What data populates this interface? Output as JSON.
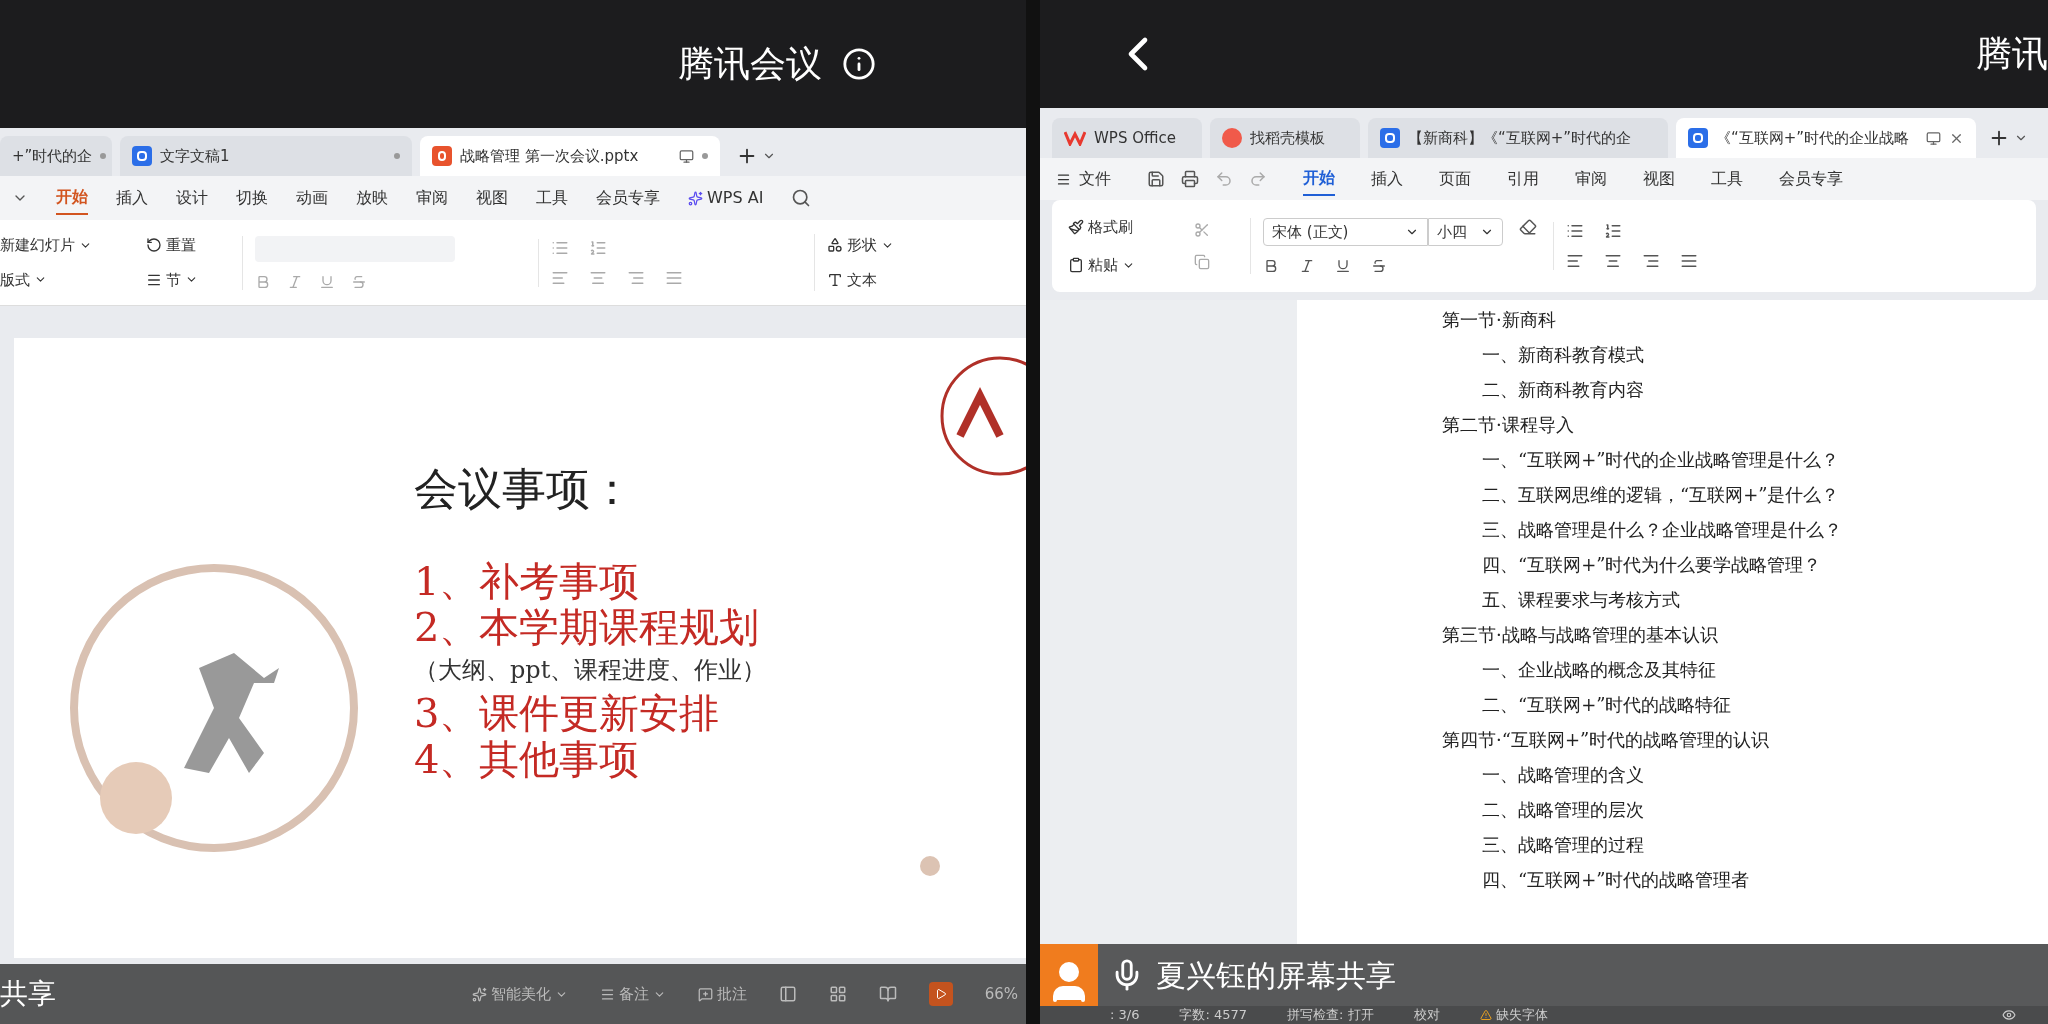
{
  "left": {
    "meeting_title": "腾讯会议",
    "tabs": [
      {
        "label": "+”时代的企",
        "kind": "none",
        "selected": false
      },
      {
        "label": "文字文稿1",
        "kind": "doc",
        "selected": false
      },
      {
        "label": "战略管理 第一次会议.pptx",
        "kind": "slides",
        "selected": true
      }
    ],
    "menu": [
      {
        "label": "开始",
        "selected": true
      },
      {
        "label": "插入",
        "selected": false
      },
      {
        "label": "设计",
        "selected": false
      },
      {
        "label": "切换",
        "selected": false
      },
      {
        "label": "动画",
        "selected": false
      },
      {
        "label": "放映",
        "selected": false
      },
      {
        "label": "审阅",
        "selected": false
      },
      {
        "label": "视图",
        "selected": false
      },
      {
        "label": "工具",
        "selected": false
      },
      {
        "label": "会员专享",
        "selected": false
      }
    ],
    "ai_label": "WPS AI",
    "ribbon": {
      "new_slide": "新建幻灯片",
      "reset": "重置",
      "layout": "版式",
      "section": "节",
      "shape": "形状",
      "textbox": "文本"
    },
    "slide": {
      "heading": "会议事项：",
      "items": [
        {
          "text": "1、补考事项",
          "kind": "main"
        },
        {
          "text": "2、本学期课程规划",
          "kind": "main"
        },
        {
          "text": "（大纲、ppt、课程进度、作业）",
          "kind": "note"
        },
        {
          "text": "3、课件更新安排",
          "kind": "main"
        },
        {
          "text": "4、其他事项",
          "kind": "main"
        }
      ]
    },
    "share_label": "共享",
    "status": {
      "beautify": "智能美化",
      "notes": "备注",
      "comment": "批注",
      "zoom": "66%"
    }
  },
  "right": {
    "meeting_title": "腾讯",
    "tabs": [
      {
        "label": "WPS Office",
        "kind": "wps",
        "selected": false
      },
      {
        "label": "找稻壳模板",
        "kind": "template",
        "selected": false
      },
      {
        "label": "【新商科】《“互联网+”时代的企",
        "kind": "doc",
        "selected": false
      },
      {
        "label": "《“互联网+”时代的企业战略",
        "kind": "doc",
        "selected": true
      }
    ],
    "file_menu": "文件",
    "menu": [
      {
        "label": "开始",
        "selected": true
      },
      {
        "label": "插入",
        "selected": false
      },
      {
        "label": "页面",
        "selected": false
      },
      {
        "label": "引用",
        "selected": false
      },
      {
        "label": "审阅",
        "selected": false
      },
      {
        "label": "视图",
        "selected": false
      },
      {
        "label": "工具",
        "selected": false
      },
      {
        "label": "会员专享",
        "selected": false
      }
    ],
    "ribbon": {
      "format_painter": "格式刷",
      "paste": "粘贴",
      "font": "宋体 (正文)",
      "size": "小四"
    },
    "outline": [
      {
        "text": "第一节·新商科",
        "children": [
          {
            "text": "一、新商科教育模式"
          },
          {
            "text": "二、新商科教育内容"
          }
        ]
      },
      {
        "text": "第二节·课程导入",
        "children": [
          {
            "text": "一、“互联网+”时代的企业战略管理是什么？"
          },
          {
            "text": "二、互联网思维的逻辑，“互联网+”是什么？"
          },
          {
            "text": "三、战略管理是什么？企业战略管理是什么？"
          },
          {
            "text": "四、“互联网+”时代为什么要学战略管理？"
          },
          {
            "text": "五、课程要求与考核方式"
          }
        ]
      },
      {
        "text": "第三节·战略与战略管理的基本认识",
        "children": [
          {
            "text": "一、企业战略的概念及其特征"
          },
          {
            "text": "二、“互联网+”时代的战略特征"
          }
        ]
      },
      {
        "text": "第四节·“互联网+”时代的战略管理的认识",
        "children": [
          {
            "text": "一、战略管理的含义"
          },
          {
            "text": "二、战略管理的层次"
          },
          {
            "text": "三、战略管理的过程"
          },
          {
            "text": "四、“互联网+”时代的战略管理者"
          }
        ]
      }
    ],
    "sharer_banner": "夏兴钰的屏幕共享",
    "status": {
      "page": ": 3/6",
      "words": "字数: 4577",
      "spell": "拼写检查: 打开",
      "proof": "校对",
      "missing_font": "缺失字体"
    }
  }
}
